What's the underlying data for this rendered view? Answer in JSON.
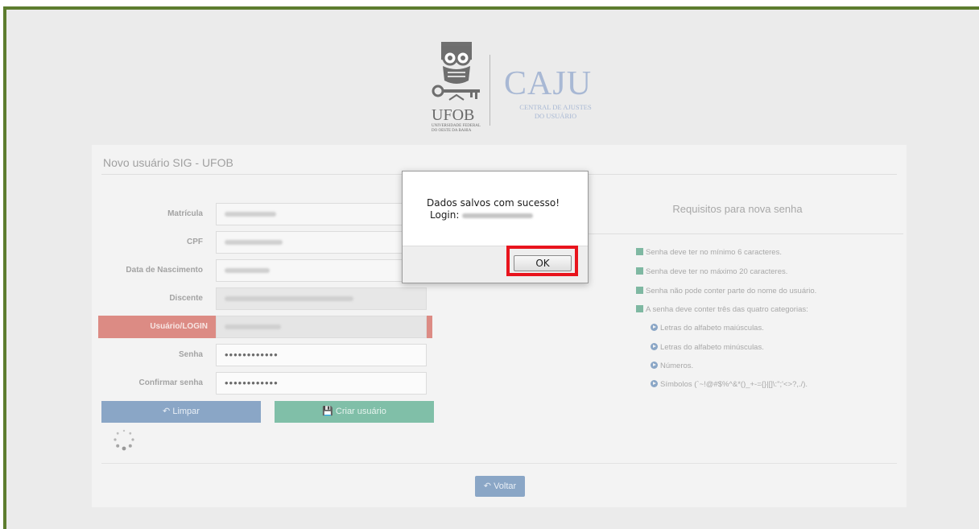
{
  "logo": {
    "university": "UFOB",
    "university_sub": "UNIVERSIDADE FEDERAL DO OESTE DA BAHIA",
    "app_name": "CAJU",
    "app_sub_line1": "CENTRAL DE AJUSTES",
    "app_sub_line2": "DO USUÁRIO"
  },
  "form": {
    "title": "Novo usuário SIG - UFOB",
    "labels": {
      "matricula": "Matrícula",
      "cpf": "CPF",
      "nascimento": "Data de Nascimento",
      "discente": "Discente",
      "login": "Usuário/LOGIN",
      "senha": "Senha",
      "confirmar": "Confirmar senha"
    },
    "values": {
      "senha": "••••••••••••",
      "confirmar": "••••••••••••"
    },
    "buttons": {
      "limpar": "Limpar",
      "criar": "Criar usuário",
      "voltar": "Voltar"
    }
  },
  "requirements": {
    "title": "Requisitos para nova senha",
    "items": [
      "Senha deve ter no mínimo 6 caracteres.",
      "Senha deve ter no máximo 20 caracteres.",
      "Senha não pode conter parte do nome do usuário.",
      "A senha deve conter três das quatro categorias:"
    ],
    "categories": [
      "Letras do alfabeto maiúsculas.",
      "Letras do alfabeto minúsculas.",
      "Números.",
      "Símbolos (`~!@#$%^&*()_+-={}|[]\\:\";'<>?,./)."
    ]
  },
  "dialog": {
    "message": "Dados salvos com sucesso!",
    "login_label": "Login:",
    "ok_label": "OK"
  },
  "colors": {
    "frame": "#5d7d2e",
    "highlight": "#e8141d",
    "error": "#dc8b84",
    "primary": "#8aa6c6",
    "success": "#80bfa8"
  }
}
